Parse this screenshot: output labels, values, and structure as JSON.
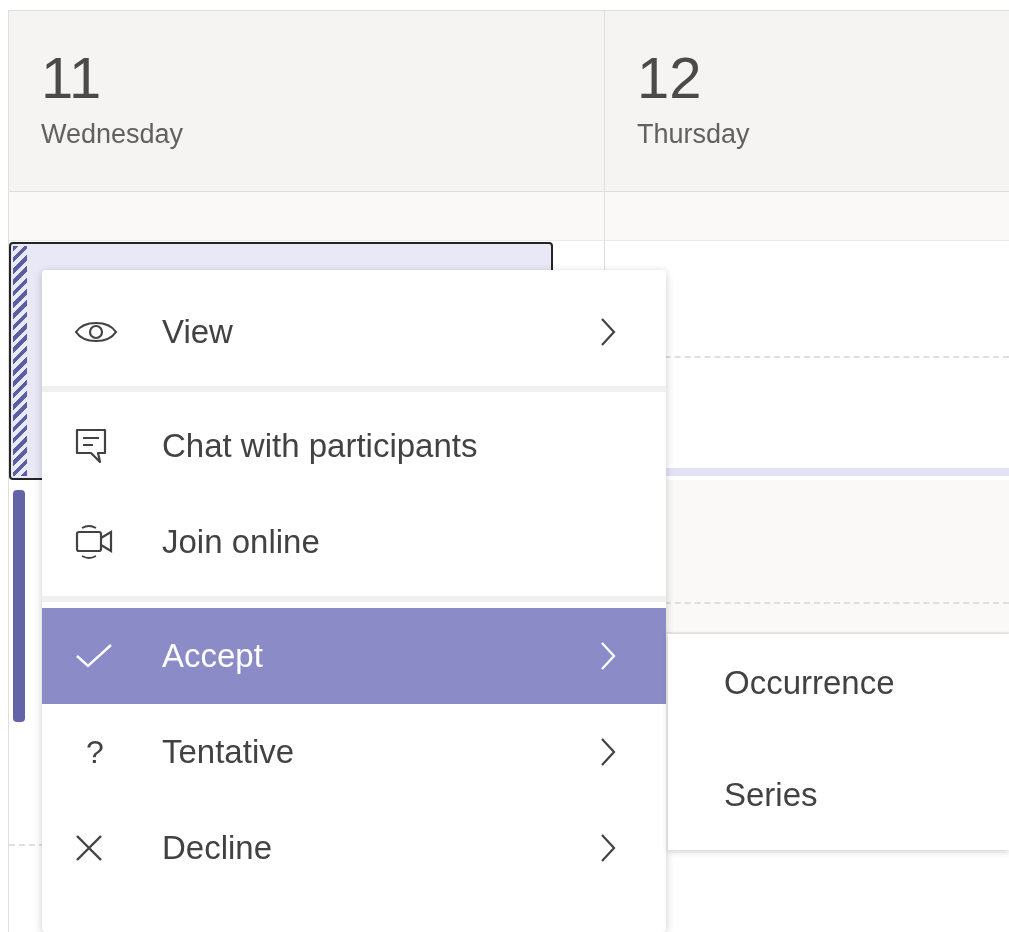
{
  "days": [
    {
      "number": "11",
      "weekday": "Wednesday"
    },
    {
      "number": "12",
      "weekday": "Thursday"
    }
  ],
  "context_menu": {
    "groups": [
      [
        {
          "label": "View",
          "kind": "eye",
          "submenu": true,
          "selected": false
        }
      ],
      [
        {
          "label": "Chat with participants",
          "kind": "chat",
          "submenu": false,
          "selected": false
        },
        {
          "label": "Join online",
          "kind": "video",
          "submenu": false,
          "selected": false
        }
      ],
      [
        {
          "label": "Accept",
          "kind": "check",
          "submenu": true,
          "selected": true
        },
        {
          "label": "Tentative",
          "kind": "glyph",
          "glyph": "?",
          "submenu": true,
          "selected": false
        },
        {
          "label": "Decline",
          "kind": "close",
          "submenu": true,
          "selected": false
        }
      ]
    ]
  },
  "submenu": {
    "items": [
      {
        "label": "Occurrence"
      },
      {
        "label": "Series"
      }
    ]
  }
}
